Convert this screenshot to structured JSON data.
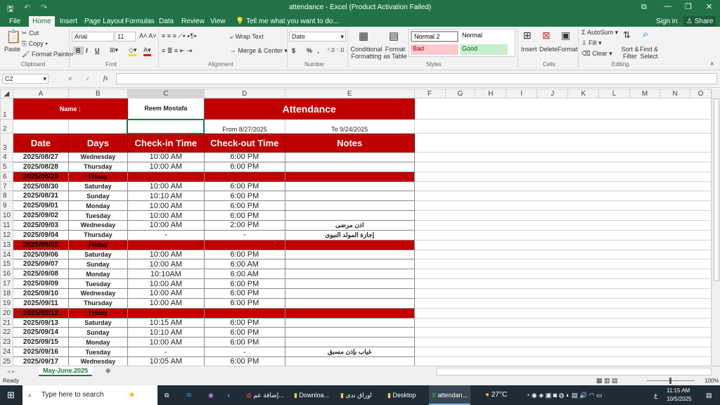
{
  "window": {
    "title": "attendance - Excel (Product Activation Failed)",
    "sign_in": "Sign in",
    "share": "Share"
  },
  "menu_tabs": [
    "File",
    "Home",
    "Insert",
    "Page Layout",
    "Formulas",
    "Data",
    "Review",
    "View"
  ],
  "tell_me": "Tell me what you want to do...",
  "ribbon": {
    "clipboard": {
      "paste": "Paste",
      "cut": "Cut",
      "copy": "Copy",
      "format_painter": "Format Painter",
      "label": "Clipboard"
    },
    "font": {
      "name": "Arial",
      "size": "11",
      "bold": "B",
      "italic": "I",
      "underline": "U",
      "label": "Font"
    },
    "alignment": {
      "wrap": "Wrap Text",
      "merge": "Merge & Center",
      "label": "Alignment"
    },
    "number": {
      "format": "Date",
      "currency": "$",
      "percent": "%",
      "comma": ",",
      "label": "Number"
    },
    "styles": {
      "conditional": "Conditional Formatting",
      "format_table": "Format as Table",
      "normal2": "Normal 2",
      "normal": "Normal",
      "bad": "Bad",
      "good": "Good",
      "label": "Styles"
    },
    "cells": {
      "insert": "Insert",
      "delete": "Delete",
      "format": "Format",
      "label": "Cells"
    },
    "editing": {
      "autosum": "AutoSum",
      "fill": "Fill",
      "clear": "Clear",
      "sort": "Sort & Filter",
      "find": "Find & Select",
      "label": "Editing"
    }
  },
  "formula_bar": {
    "name_box": "C2",
    "fx": "fx",
    "value": ""
  },
  "columns": [
    "A",
    "B",
    "C",
    "D",
    "E",
    "F",
    "G",
    "H",
    "I",
    "J",
    "K",
    "L",
    "M",
    "N",
    "O"
  ],
  "sheet": {
    "name_label": "Name :",
    "name_value": "Reem Mostafa",
    "title": "Attendance",
    "from": "From 8/27/2025",
    "to": "To 9/24/2025",
    "headers": [
      "Date",
      "Days",
      "Check-in Time",
      "Check-out Time",
      "Notes"
    ],
    "rows": [
      {
        "n": "4",
        "date": "2025/08/27",
        "day": "Wednesday",
        "in": "10:00 AM",
        "out": "6:00 PM",
        "note": "",
        "off": false
      },
      {
        "n": "5",
        "date": "2025/08/28",
        "day": "Thursday",
        "in": "10:00 AM",
        "out": "6:00 PM",
        "note": "",
        "off": false
      },
      {
        "n": "6",
        "date": "2025/08/29",
        "day": "Friday",
        "in": "",
        "out": "",
        "note": "",
        "off": true
      },
      {
        "n": "7",
        "date": "2025/08/30",
        "day": "Saturday",
        "in": "10:00 AM",
        "out": "6:00 PM",
        "note": "",
        "off": false
      },
      {
        "n": "8",
        "date": "2025/08/31",
        "day": "Sunday",
        "in": "10:10 AM",
        "out": "6:00 PM",
        "note": "",
        "off": false
      },
      {
        "n": "9",
        "date": "2025/09/01",
        "day": "Monday",
        "in": "10:00 AM",
        "out": "6:00 PM",
        "note": "",
        "off": false
      },
      {
        "n": "10",
        "date": "2025/09/02",
        "day": "Tuesday",
        "in": "10:00 AM",
        "out": "6:00 PM",
        "note": "",
        "off": false
      },
      {
        "n": "11",
        "date": "2025/09/03",
        "day": "Wednesday",
        "in": "10:00 AM",
        "out": "2:00 PM",
        "note": "اذن مرضى",
        "off": false
      },
      {
        "n": "12",
        "date": "2025/09/04",
        "day": "Thursday",
        "in": "-",
        "out": "-",
        "note": "إجازة المولد النبوى",
        "off": false
      },
      {
        "n": "13",
        "date": "2025/09/05",
        "day": "Friday",
        "in": "",
        "out": "",
        "note": "",
        "off": true
      },
      {
        "n": "14",
        "date": "2025/09/06",
        "day": "Saturday",
        "in": "10:00 AM",
        "out": "6:00 PM",
        "note": "",
        "off": false
      },
      {
        "n": "15",
        "date": "2025/09/07",
        "day": "Sunday",
        "in": "10:00 AM",
        "out": "6:00 AM",
        "note": "",
        "off": false
      },
      {
        "n": "16",
        "date": "2025/09/08",
        "day": "Monday",
        "in": "10:10AM",
        "out": "6:00 AM",
        "note": "",
        "off": false
      },
      {
        "n": "17",
        "date": "2025/09/09",
        "day": "Tuesday",
        "in": "10:00 AM",
        "out": "6:00 PM",
        "note": "",
        "off": false
      },
      {
        "n": "18",
        "date": "2025/09/10",
        "day": "Wednesday",
        "in": "10:00 AM",
        "out": "6:00 PM",
        "note": "",
        "off": false
      },
      {
        "n": "19",
        "date": "2025/09/11",
        "day": "Thursday",
        "in": "10:00 AM",
        "out": "6:00 PM",
        "note": "",
        "off": false
      },
      {
        "n": "20",
        "date": "2025/09/12",
        "day": "Friday",
        "in": "",
        "out": "",
        "note": "",
        "off": true
      },
      {
        "n": "21",
        "date": "2025/09/13",
        "day": "Saturday",
        "in": "10:15 AM",
        "out": "6:00 PM",
        "note": "",
        "off": false
      },
      {
        "n": "22",
        "date": "2025/09/14",
        "day": "Sunday",
        "in": "10:10 AM",
        "out": "6:00 PM",
        "note": "",
        "off": false
      },
      {
        "n": "23",
        "date": "2025/09/15",
        "day": "Monday",
        "in": "10:00 AM",
        "out": "6:00 PM",
        "note": "",
        "off": false
      },
      {
        "n": "24",
        "date": "2025/09/16",
        "day": "Tuesday",
        "in": "-",
        "out": "-",
        "note": "غياب بإذن مسبق",
        "off": false
      },
      {
        "n": "25",
        "date": "2025/09/17",
        "day": "Wednesday",
        "in": "10:05 AM",
        "out": "6:00 PM",
        "note": "",
        "off": false
      }
    ]
  },
  "sheet_tab": "May-June.2025",
  "status": {
    "ready": "Ready",
    "zoom": "100%"
  },
  "taskbar": {
    "search": "Type here to search",
    "apps": [
      "إضافة عم...",
      "Downloa...",
      "اوراق ندى",
      "Desktop",
      "attendan..."
    ],
    "weather": "27°C",
    "time": "11:15 AM",
    "date": "10/5/2025",
    "lang": "ع"
  },
  "colors": {
    "excel_green": "#217346",
    "header_red": "#c00000"
  }
}
